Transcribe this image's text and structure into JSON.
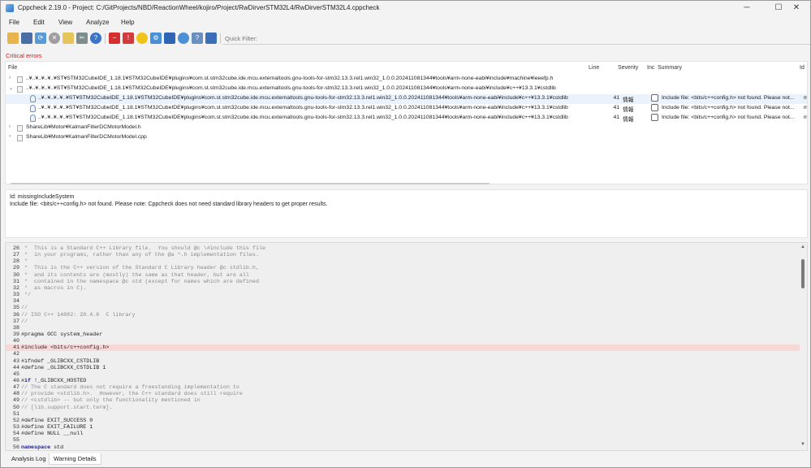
{
  "window": {
    "title": "Cppcheck 2.19.0 - Project: C:/GitProjects/NBD/ReactionWheel/kojiro/Project/RwDirverSTM32L4/RwDirverSTM32L4.cppcheck",
    "controls": [
      "─",
      "☐",
      "✕"
    ]
  },
  "menu": [
    "File",
    "Edit",
    "View",
    "Analyze",
    "Help"
  ],
  "toolbar": {
    "icons": [
      "open-folder-icon",
      "save-icon",
      "reload-icon",
      "stop-icon",
      "clear-icon",
      "settings-icon",
      "help-icon",
      "show-errors-icon",
      "show-warnings-icon",
      "show-style-icon",
      "show-performance-icon",
      "show-portability-icon",
      "show-information-icon",
      "show-checkers-icon"
    ],
    "quick_filter_placeholder": "Quick Filter:"
  },
  "critical_errors_label": "Critical errors",
  "results": {
    "columns": [
      "File",
      "Line",
      "Severity",
      "Inc",
      "Summary",
      "Id"
    ],
    "rows": [
      {
        "level": 0,
        "expander": "›",
        "file": "..¥..¥..¥..¥..¥ST¥STM32CubeIDE_1.18.1¥STM32CubeIDE¥plugins¥com.st.stm32cube.ide.mcu.externaltools.gnu-tools-for-stm32.13.3.rel1.win32_1.0.0.202411081344¥tools¥arm-none-eabi¥include¥machine¥ieeefp.h",
        "line": "",
        "severity": "",
        "summary": "",
        "id": ""
      },
      {
        "level": 0,
        "expander": "⌄",
        "file": "..¥..¥..¥..¥..¥ST¥STM32CubeIDE_1.18.1¥STM32CubeIDE¥plugins¥com.st.stm32cube.ide.mcu.externaltools.gnu-tools-for-stm32.13.3.rel1.win32_1.0.0.202411081344¥tools¥arm-none-eabi¥include¥c++¥13.3.1¥cstdlib",
        "line": "",
        "severity": "",
        "summary": "",
        "id": ""
      },
      {
        "level": 1,
        "expander": "",
        "file": "..¥..¥..¥..¥..¥ST¥STM32CubeIDE_1.18.1¥STM32CubeIDE¥plugins¥com.st.stm32cube.ide.mcu.externaltools.gnu-tools-for-stm32.13.3.rel1.win32_1.0.0.202411081344¥tools¥arm-none-eabi¥include¥c++¥13.3.1¥cstdlib",
        "line": "41",
        "severity": "情報",
        "summary": "Include file: <bits/c++config.h> not found. Please not...",
        "id": "mis"
      },
      {
        "level": 1,
        "expander": "",
        "file": "..¥..¥..¥..¥..¥ST¥STM32CubeIDE_1.18.1¥STM32CubeIDE¥plugins¥com.st.stm32cube.ide.mcu.externaltools.gnu-tools-for-stm32.13.3.rel1.win32_1.0.0.202411081344¥tools¥arm-none-eabi¥include¥c++¥13.3.1¥cstdlib",
        "line": "41",
        "severity": "情報",
        "summary": "Include file: <bits/c++config.h> not found. Please not...",
        "id": "mis"
      },
      {
        "level": 1,
        "expander": "",
        "file": "..¥..¥..¥..¥..¥ST¥STM32CubeIDE_1.18.1¥STM32CubeIDE¥plugins¥com.st.stm32cube.ide.mcu.externaltools.gnu-tools-for-stm32.13.3.rel1.win32_1.0.0.202411081344¥tools¥arm-none-eabi¥include¥c++¥13.3.1¥cstdlib",
        "line": "41",
        "severity": "情報",
        "summary": "Include file: <bits/c++config.h> not found. Please not...",
        "id": "mis"
      },
      {
        "level": 0,
        "expander": "›",
        "file": "ShareLib¥Motor¥KalmanFilterDCMotorModel.h",
        "line": "",
        "severity": "",
        "summary": "",
        "id": ""
      },
      {
        "level": 0,
        "expander": "›",
        "file": "ShareLib¥Motor¥KalmanFilterDCMotorModel.cpp",
        "line": "",
        "severity": "",
        "summary": "",
        "id": ""
      }
    ]
  },
  "details": {
    "id_line": "Id: missingIncludeSystem",
    "message": "Include file: <bits/c++config.h> not found. Please note: Cppcheck does not need standard library headers to get proper results."
  },
  "code": {
    "highlight_line": 41,
    "lines": [
      {
        "n": "26",
        "t": " *  This is a Standard C++ Library file.  You should @c \\#include this file",
        "c": true
      },
      {
        "n": "27",
        "t": " *  in your programs, rather than any of the @a *.h implementation files.",
        "c": true
      },
      {
        "n": "28",
        "t": " *",
        "c": true
      },
      {
        "n": "29",
        "t": " *  This is the C++ version of the Standard C Library header @c stdlib.h,",
        "c": true
      },
      {
        "n": "30",
        "t": " *  and its contents are (mostly) the same as that header, but are all",
        "c": true
      },
      {
        "n": "31",
        "t": " *  contained in the namespace @c std (except for names which are defined",
        "c": true
      },
      {
        "n": "32",
        "t": " *  as macros in C).",
        "c": true
      },
      {
        "n": "33",
        "t": " */",
        "c": true
      },
      {
        "n": "34",
        "t": "",
        "c": false
      },
      {
        "n": "35",
        "t": "//",
        "c": true
      },
      {
        "n": "36",
        "t": "// ISO C++ 14882: 20.4.6  C library",
        "c": true
      },
      {
        "n": "37",
        "t": "//",
        "c": true
      },
      {
        "n": "38",
        "t": "",
        "c": false
      },
      {
        "n": "39",
        "t": "#pragma GCC system_header",
        "c": false
      },
      {
        "n": "40",
        "t": "",
        "c": false
      },
      {
        "n": "41",
        "t": "#include <bits/c++config.h>",
        "c": false
      },
      {
        "n": "42",
        "t": "",
        "c": false
      },
      {
        "n": "43",
        "t": "#ifndef _GLIBCXX_CSTDLIB",
        "c": false
      },
      {
        "n": "44",
        "t": "#define _GLIBCXX_CSTDLIB 1",
        "c": false
      },
      {
        "n": "45",
        "t": "",
        "c": false
      },
      {
        "n": "46",
        "t": "#if !_GLIBCXX_HOSTED",
        "c": false,
        "kw": "if"
      },
      {
        "n": "47",
        "t": "// The C standard does not require a freestanding implementation to",
        "c": true
      },
      {
        "n": "48",
        "t": "// provide <stdlib.h>.  However, the C++ standard does still require",
        "c": true
      },
      {
        "n": "49",
        "t": "// <cstdlib> -- but only the functionality mentioned in",
        "c": true
      },
      {
        "n": "50",
        "t": "// [lib.support.start.term].",
        "c": true
      },
      {
        "n": "51",
        "t": "",
        "c": false
      },
      {
        "n": "52",
        "t": "#define EXIT_SUCCESS 0",
        "c": false
      },
      {
        "n": "53",
        "t": "#define EXIT_FAILURE 1",
        "c": false
      },
      {
        "n": "54",
        "t": "#define NULL __null",
        "c": false
      },
      {
        "n": "55",
        "t": "",
        "c": false
      },
      {
        "n": "56",
        "t": "namespace std",
        "c": false,
        "kw": "namespace"
      }
    ]
  },
  "tabs": [
    "Analysis Log",
    "Warning Details"
  ],
  "colors": {
    "critical": "#d01c1c",
    "highlight": "#f8d7d7",
    "keyword": "#1a1aa6"
  }
}
